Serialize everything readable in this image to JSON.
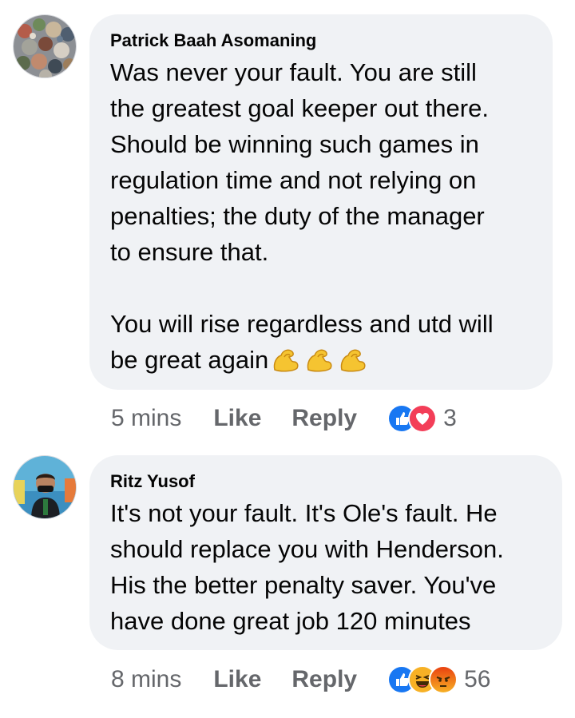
{
  "comments": [
    {
      "author": "Patrick Baah Asomaning",
      "text_lines": [
        "Was never your fault. You are still",
        "the greatest goal keeper out there.",
        "Should be winning such games in",
        "regulation time and not relying on",
        "penalties; the duty of the manager",
        "to ensure that.",
        "",
        "You will rise regardless and utd will",
        "be great again"
      ],
      "trailing_emojis": [
        "flexed-biceps",
        "flexed-biceps",
        "flexed-biceps"
      ],
      "time": "5 mins",
      "like_label": "Like",
      "reply_label": "Reply",
      "reactions": [
        "like",
        "love"
      ],
      "reaction_count": "3"
    },
    {
      "author": "Ritz Yusof",
      "text_lines": [
        "It's not your fault. It's Ole's fault. He",
        "should replace you with Henderson.",
        "His the better penalty saver. You've",
        "have done great job 120 minutes"
      ],
      "time": "8 mins",
      "like_label": "Like",
      "reply_label": "Reply",
      "reactions": [
        "like",
        "haha",
        "angry"
      ],
      "reaction_count": "56"
    }
  ],
  "colors": {
    "bubble": "#f0f2f5",
    "meta_text": "#65676b",
    "like_blue": "#1877f2",
    "love_red": "#f33e58",
    "haha_yellow": "#f7b125",
    "angry_orange": "#e9710f"
  }
}
